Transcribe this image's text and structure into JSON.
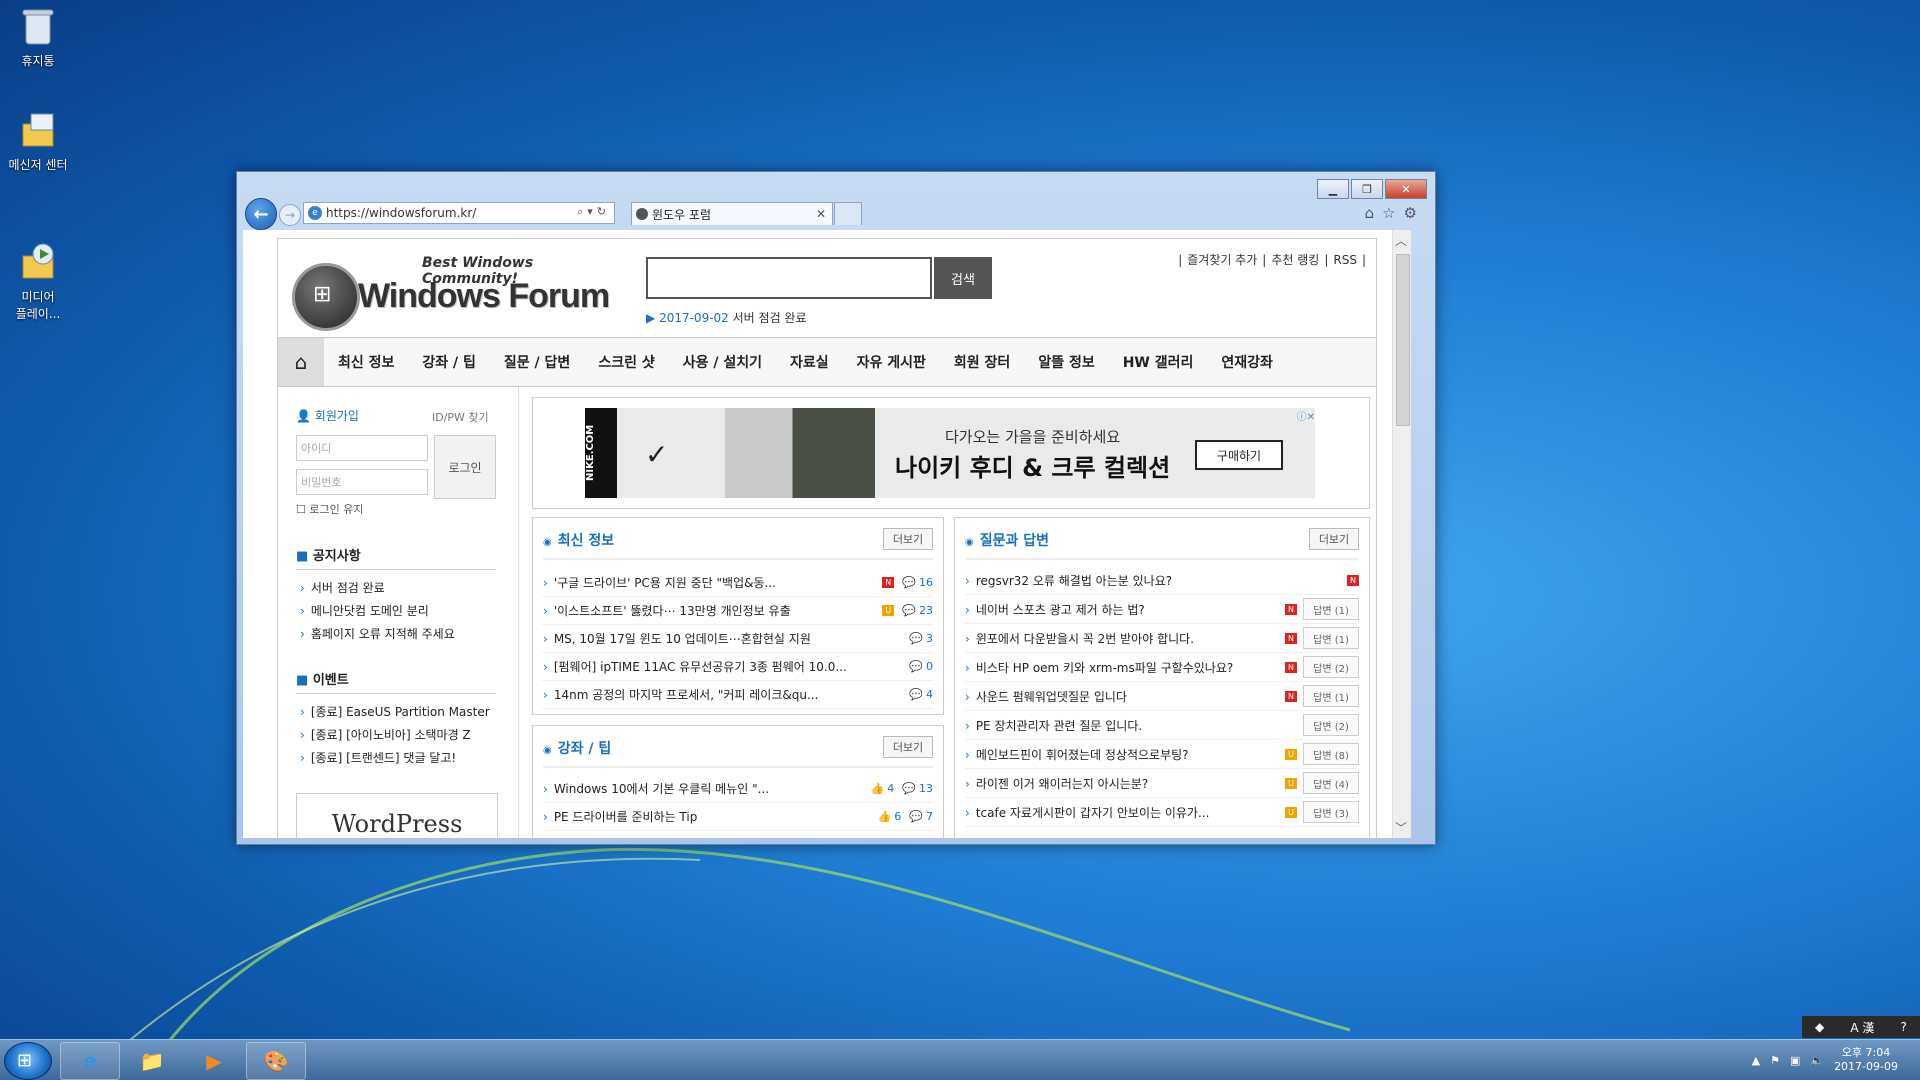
{
  "desktop": {
    "icons": [
      {
        "label": "휴지통",
        "icon": "recycle-bin-icon"
      },
      {
        "label": "메신저 센터",
        "icon": "messenger-center-icon"
      },
      {
        "label": "미디어\n플레이...",
        "icon": "media-player-icon"
      }
    ]
  },
  "browser": {
    "url": "https://windowsforum.kr/",
    "tab_title": "윈도우 포럼",
    "window_controls": [
      "minimize",
      "maximize",
      "close"
    ]
  },
  "site": {
    "tagline": "Best Windows Community!",
    "name": "Windows Forum",
    "search_button": "검색",
    "notice_date": "2017-09-02",
    "notice_text": "서버 점검 완료",
    "toplinks": [
      "즐겨찾기 추가",
      "추천 랭킹",
      "RSS"
    ],
    "menu": [
      "최신 정보",
      "강좌 / 팁",
      "질문 / 답변",
      "스크린 샷",
      "사용 / 설치기",
      "자료실",
      "자유 게시판",
      "회원 장터",
      "알뜰 정보",
      "HW 갤러리",
      "연재강좌"
    ],
    "login": {
      "signup": "회원가입",
      "find": "ID/PW 찾기",
      "id_placeholder": "아이디",
      "pw_placeholder": "비밀번호",
      "login_button": "로그인",
      "keep": "로그인 유지"
    },
    "notices": {
      "title": "공지사항",
      "items": [
        "서버 점검 완료",
        "메니안닷컴 도메인 분리",
        "홈페이지 오류 지적해 주세요"
      ]
    },
    "events": {
      "title": "이벤트",
      "items": [
        "[종료] EaseUS Partition Master",
        "[종료] [아이노비아] 소택마경 Z",
        "[종료] [트랜센드] 댓글 달고!"
      ]
    },
    "wordpress": "WordPress",
    "ad": {
      "brand": "NIKE.COM",
      "subtitle": "다가오는 가을을 준비하세요",
      "headline": "나이키 후디 & 크루 컬렉션",
      "button": "구매하기"
    },
    "latest": {
      "title": "최신 정보",
      "more": "더보기",
      "rows": [
        {
          "text": "'구글 드라이브' PC용 지원 중단 \"백업&동...",
          "tag": "N",
          "count": "16"
        },
        {
          "text": "'이스트소프트' 뚫렸다⋯ 13만명 개인정보 유출",
          "tag": "U",
          "count": "23"
        },
        {
          "text": "MS, 10월 17일 윈도 10 업데이트⋯혼합현실 지원",
          "tag": "",
          "count": "3"
        },
        {
          "text": "[펌웨어] ipTIME 11AC 유무선공유기 3종 펌웨어 10.0...",
          "tag": "",
          "count": "0"
        },
        {
          "text": "14nm 공정의 마지막 프로세서, \"커피 레이크&qu...",
          "tag": "",
          "count": "4"
        }
      ]
    },
    "tips": {
      "title": "강좌 / 팁",
      "more": "더보기",
      "rows": [
        {
          "text": "Windows 10에서 기본 우클릭 메뉴인 \"...",
          "likes": "4",
          "count": "13"
        },
        {
          "text": "PE 드라이버를 준비하는 Tip",
          "likes": "6",
          "count": "7"
        }
      ]
    },
    "qna": {
      "title": "질문과 답변",
      "more": "더보기",
      "rows": [
        {
          "text": "regsvr32 오류 해결법 아는분 있나요?",
          "tag": "N",
          "answer": ""
        },
        {
          "text": "네이버 스포츠 광고 제거 하는 법?",
          "tag": "N",
          "answer": "답변 (1)"
        },
        {
          "text": "윈포에서 다운받을시 꼭 2번 받아야 합니다.",
          "tag": "N",
          "answer": "답변 (1)"
        },
        {
          "text": "비스타 HP oem 키와 xrm-ms파일 구할수있나요?",
          "tag": "N",
          "answer": "답변 (2)"
        },
        {
          "text": "사운드 펌웨워업뎃질문 입니다",
          "tag": "N",
          "answer": "답변 (1)"
        },
        {
          "text": "PE 장치관리자 관련 질문 입니다.",
          "tag": "",
          "answer": "답변 (2)"
        },
        {
          "text": "메인보드핀이 휘어졌는데 정상적으로부팅?",
          "tag": "U",
          "answer": "답변 (8)"
        },
        {
          "text": "라이젠 이거 왜이러는지 아시는분?",
          "tag": "U",
          "answer": "답변 (4)"
        },
        {
          "text": "tcafe 자료게시판이 갑자기 안보이는 이유가...",
          "tag": "U",
          "answer": "답변 (3)"
        }
      ]
    }
  },
  "taskbar": {
    "apps": [
      "ie-icon",
      "explorer-icon",
      "media-player-icon",
      "paint-icon"
    ],
    "time": "오후 7:04",
    "date": "2017-09-09",
    "ime": "A 漢"
  },
  "colors": {
    "accent": "#1a6fbf",
    "new_tag": "#d9251d",
    "updated_tag": "#f0a400"
  }
}
